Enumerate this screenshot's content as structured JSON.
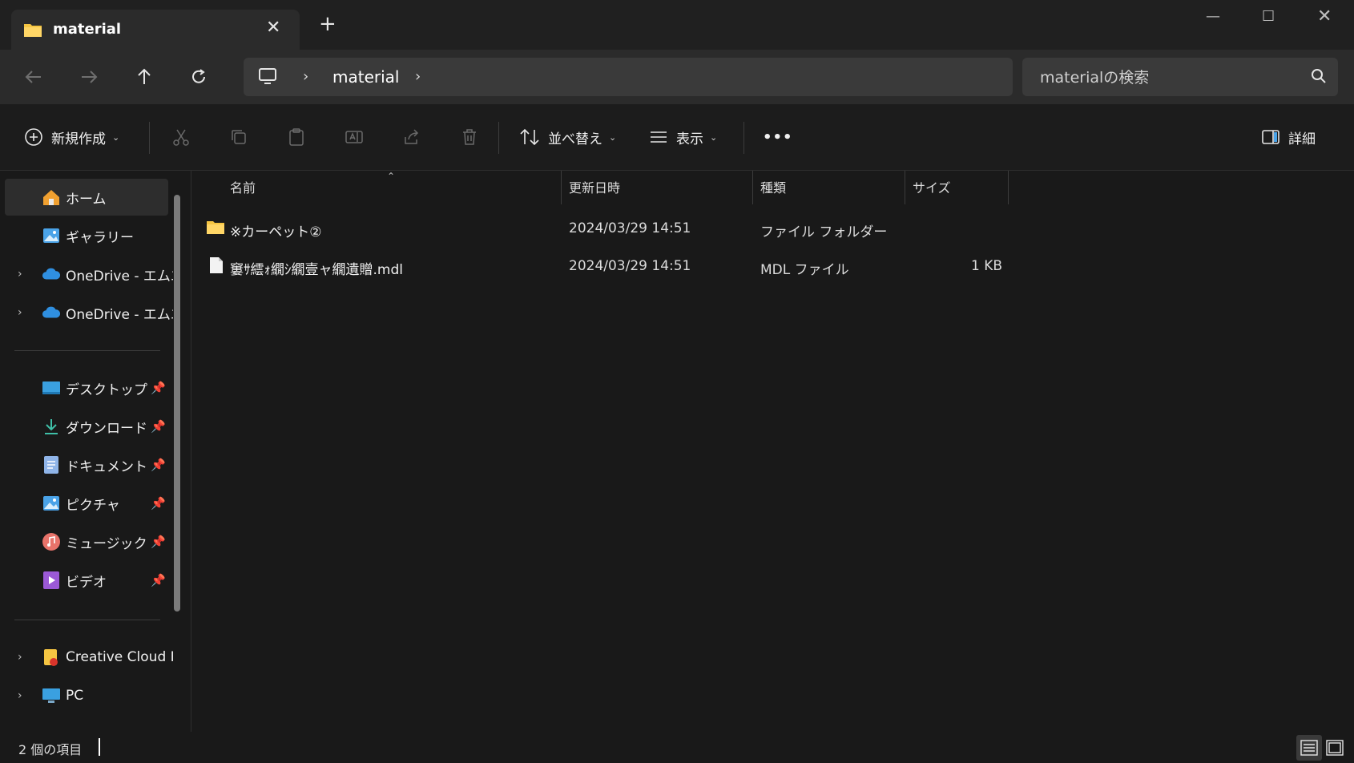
{
  "titlebar": {
    "tab_title": "material",
    "tab_close": "✕",
    "new_tab": "+",
    "minimize": "—",
    "maximize": "☐",
    "close": "✕"
  },
  "navbar": {
    "address_segment": "material",
    "search_placeholder": "materialの検索"
  },
  "commandbar": {
    "new_label": "新規作成",
    "sort_label": "並べ替え",
    "view_label": "表示",
    "more_label": "•••",
    "details_label": "詳細"
  },
  "sidebar": {
    "home": "ホーム",
    "gallery": "ギャラリー",
    "onedrive1": "OneDrive - エムエ",
    "onedrive2": "OneDrive - エムエ",
    "desktop": "デスクトップ",
    "downloads": "ダウンロード",
    "documents": "ドキュメント",
    "pictures": "ピクチャ",
    "music": "ミュージック",
    "videos": "ビデオ",
    "creative_cloud": "Creative Cloud F",
    "pc": "PC"
  },
  "columns": {
    "name": "名前",
    "modified": "更新日時",
    "type": "種類",
    "size": "サイズ"
  },
  "files": [
    {
      "name": "※カーペット②",
      "modified": "2024/03/29 14:51",
      "type": "ファイル フォルダー",
      "size": "",
      "kind": "folder"
    },
    {
      "name": "窶ｻ繧ｫ繝ｼ繝壹ャ繝遺贈.mdl",
      "modified": "2024/03/29 14:51",
      "type": "MDL ファイル",
      "size": "1 KB",
      "kind": "file"
    }
  ],
  "status": {
    "item_count": "2 個の項目"
  },
  "colors": {
    "folder_yellow": "#f5c542",
    "window_bg": "#191919",
    "accent_blue": "#4aa3e8"
  }
}
